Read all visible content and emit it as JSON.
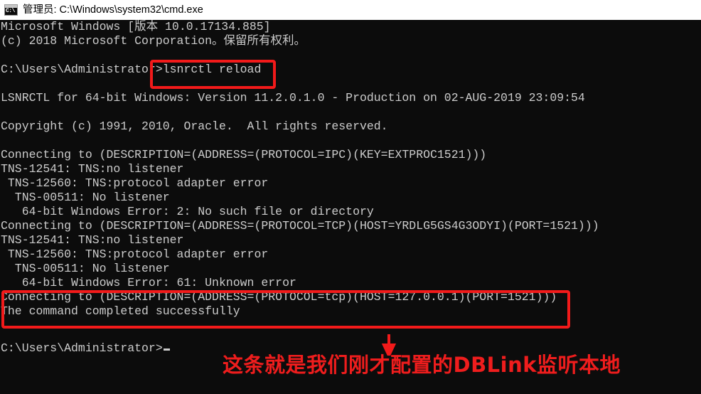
{
  "window": {
    "title": "管理员: C:\\Windows\\system32\\cmd.exe",
    "icon": "cmd-console-icon",
    "icon_glyph": "C:\\",
    "titlebar_background": "#ffffff",
    "console_background": "#0c0c0c",
    "console_foreground": "#cccccc"
  },
  "console": {
    "lines": [
      "Microsoft Windows [版本 10.0.17134.885]",
      "(c) 2018 Microsoft Corporation。保留所有权利。",
      "",
      "C:\\Users\\Administrator>lsnrctl reload",
      "",
      "LSNRCTL for 64-bit Windows: Version 11.2.0.1.0 - Production on 02-AUG-2019 23:09:54",
      "",
      "Copyright (c) 1991, 2010, Oracle.  All rights reserved.",
      "",
      "Connecting to (DESCRIPTION=(ADDRESS=(PROTOCOL=IPC)(KEY=EXTPROC1521)))",
      "TNS-12541: TNS:no listener",
      " TNS-12560: TNS:protocol adapter error",
      "  TNS-00511: No listener",
      "   64-bit Windows Error: 2: No such file or directory",
      "Connecting to (DESCRIPTION=(ADDRESS=(PROTOCOL=TCP)(HOST=YRDLG5GS4G3ODYI)(PORT=1521)))",
      "TNS-12541: TNS:no listener",
      " TNS-12560: TNS:protocol adapter error",
      "  TNS-00511: No listener",
      "   64-bit Windows Error: 61: Unknown error",
      "Connecting to (DESCRIPTION=(ADDRESS=(PROTOCOL=tcp)(HOST=127.0.0.1)(PORT=1521)))",
      "The command completed successfully",
      ""
    ],
    "final_prompt": "C:\\Users\\Administrator>",
    "cursor": "block-cursor"
  },
  "annotations": {
    "color": "#f21a1a",
    "command_highlight_label": "lsnrctl reload",
    "success_highlight_label": "The command completed successfully",
    "arrow": "down-arrow",
    "caption": "这条就是我们刚才配置的DBLink监听本地"
  }
}
